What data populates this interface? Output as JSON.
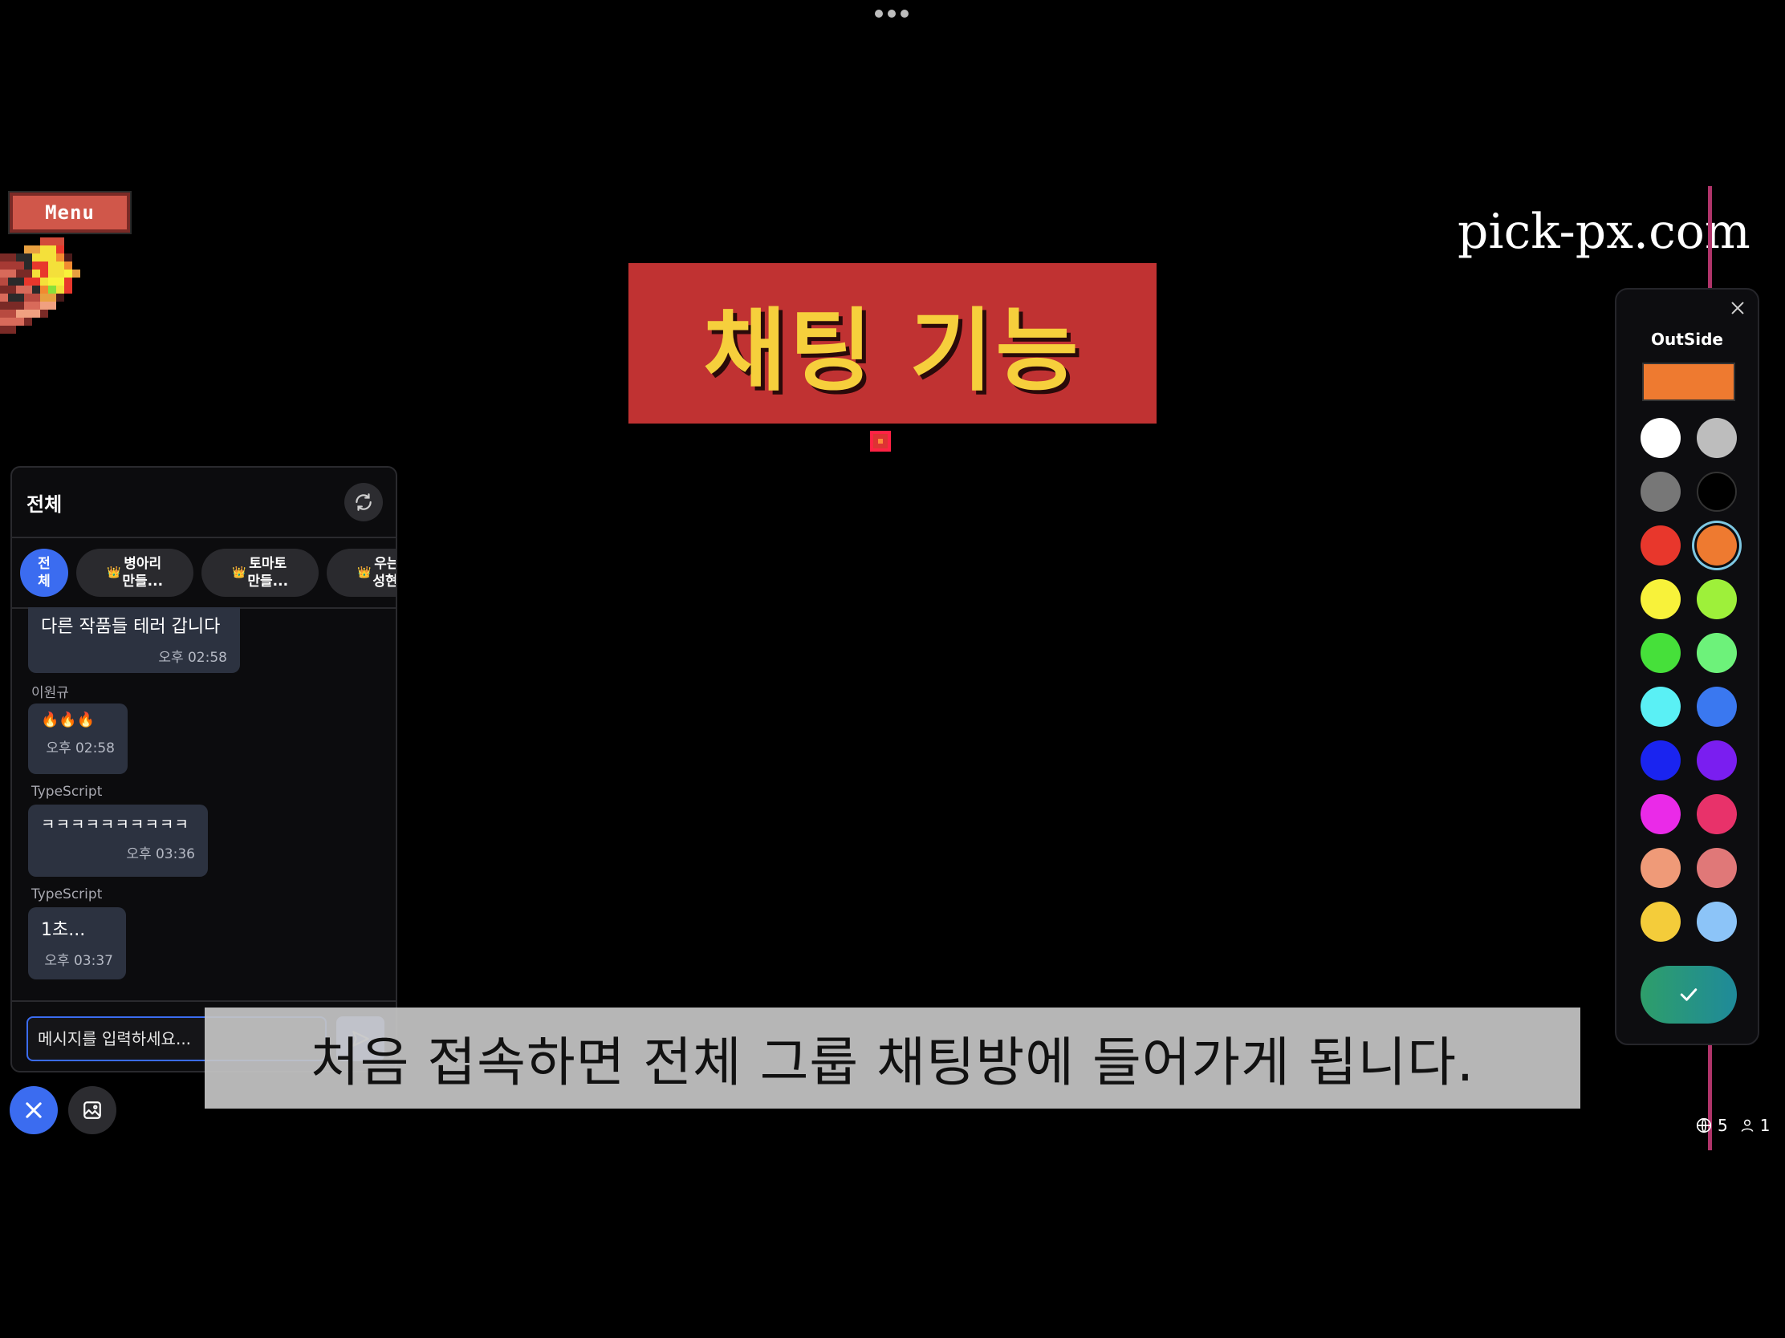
{
  "window": {
    "dots_label": "more-options"
  },
  "menu": {
    "label": "Menu"
  },
  "title_banner": {
    "text": "채팅 기능"
  },
  "watermark": {
    "text": "pick-px.com"
  },
  "chat": {
    "title": "전체",
    "chips": [
      {
        "label": "전\n체",
        "active": true
      },
      {
        "label": "병아리\n만들...",
        "crown": "👑"
      },
      {
        "label": "토마토\n만들...",
        "crown": "👑"
      },
      {
        "label": "우는박\n성현...",
        "crown": "👑"
      }
    ],
    "messages": [
      {
        "sender": "",
        "text": "다른 작품들 테러 갑니다",
        "time": "오후 02:58"
      },
      {
        "sender": "이원규",
        "text": "🔥🔥🔥",
        "time": "오후 02:58"
      },
      {
        "sender": "TypeScript",
        "text": "ㅋㅋㅋㅋㅋㅋㅋㅋㅋㅋ",
        "time": "오후 03:36"
      },
      {
        "sender": "TypeScript",
        "text": "1초...",
        "time": "오후 03:37"
      }
    ],
    "input_placeholder": "메시지를 입력하세요..."
  },
  "color_picker": {
    "title": "OutSide",
    "current_color": "#ee7a30",
    "colors": [
      "#ffffff",
      "#bdbdbd",
      "#777777",
      "#000000",
      "#e8372c",
      "#ee7a30",
      "#f8f23a",
      "#9ef03a",
      "#46e03a",
      "#6df27a",
      "#5af0f5",
      "#3a78f0",
      "#1a24f0",
      "#7a1ef0",
      "#ea2ae8",
      "#e8326a",
      "#ef9a78",
      "#e07878",
      "#f4cc3a",
      "#8cc4f8"
    ],
    "selected_index": 5
  },
  "status": {
    "online_count": "5",
    "user_count": "1"
  },
  "caption": {
    "text": "처음 접속하면 전체 그룹 채팅방에 들어가게 됩니다."
  }
}
